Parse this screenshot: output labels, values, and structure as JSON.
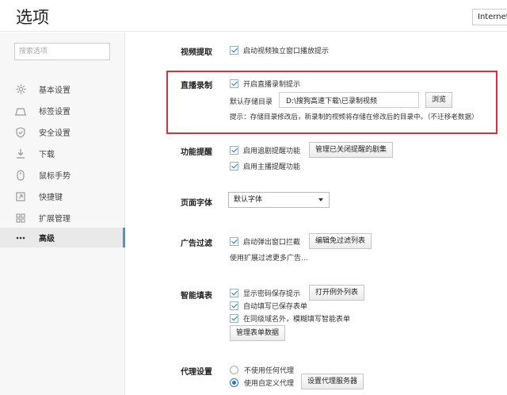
{
  "header": {
    "title": "选项",
    "internet_label": "Internet选"
  },
  "sidebar": {
    "search_placeholder": "搜索选项",
    "items": [
      {
        "label": "基本设置",
        "icon": "gear-icon"
      },
      {
        "label": "标签设置",
        "icon": "tab-icon"
      },
      {
        "label": "安全设置",
        "icon": "shield-icon"
      },
      {
        "label": "下载",
        "icon": "download-icon"
      },
      {
        "label": "鼠标手势",
        "icon": "mouse-icon"
      },
      {
        "label": "快捷键",
        "icon": "shortcut-icon"
      },
      {
        "label": "扩展管理",
        "icon": "extensions-icon"
      },
      {
        "label": "高级",
        "icon": "more-icon"
      }
    ],
    "active_index": 7
  },
  "sections": {
    "video": {
      "label": "视频提取",
      "checkbox": {
        "label": "启动视频独立窗口播放提示",
        "checked": true
      }
    },
    "live": {
      "label": "直播录制",
      "checkbox": {
        "label": "开启直播录制提示",
        "checked": true
      },
      "path_label": "默认存储目录",
      "path_value": "D:\\搜狗高速下载\\已录制视频",
      "browse_label": "浏览",
      "hint": "提示：存储目录修改后，新录制的视频将存储在修改后的目录中。（不迁移老数据）"
    },
    "reminder": {
      "label": "功能提醒",
      "checkbox1": {
        "label": "启用追剧提醒功能",
        "checked": true
      },
      "manage_label": "管理已关闭提醒的剧集",
      "checkbox2": {
        "label": "启用主播提醒功能",
        "checked": true
      }
    },
    "font": {
      "label": "页面字体",
      "selected": "默认字体"
    },
    "adblock": {
      "label": "广告过滤",
      "checkbox": {
        "label": "启动弹出窗口拦截",
        "checked": true
      },
      "edit_label": "编辑免过滤列表",
      "more_text": "使用扩展过滤更多广告..."
    },
    "autofill": {
      "label": "智能填表",
      "checkbox1": {
        "label": "显示密码保存提示",
        "checked": true
      },
      "exceptions_label": "打开例外列表",
      "checkbox2": {
        "label": "自动填写已保存表单",
        "checked": true
      },
      "checkbox3": {
        "label": "在同级域名外，模糊填写智能表单",
        "checked": true
      },
      "manage_label": "管理表单数据"
    },
    "proxy": {
      "label": "代理设置",
      "radio1": {
        "label": "不使用任何代理",
        "selected": false
      },
      "radio2": {
        "label": "使用自定义代理",
        "selected": true
      },
      "set_label": "设置代理服务器"
    }
  },
  "colors": {
    "highlight": "#d9313c",
    "accent": "#4a90e2"
  }
}
